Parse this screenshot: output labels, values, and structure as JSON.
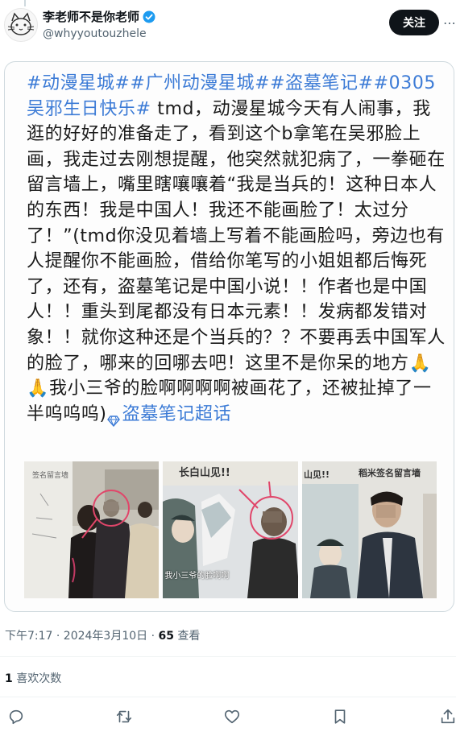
{
  "header": {
    "display_name": "李老师不是你老师",
    "handle": "@whyyoutouzhele",
    "follow_label": "关注",
    "more_label": "⋯"
  },
  "quote": {
    "hashtags": "#动漫星城##广州动漫星城##盗墓笔记##0305吴邪生日快乐#",
    "body": " tmd，动漫星城今天有人闹事，我逛的好好的准备走了，看到这个b拿笔在吴邪脸上画，我走过去刚想提醒，他突然就犯病了，一拳砸在留言墙上，嘴里瞎嚷嚷着“我是当兵的！这种日本人的东西！我是中国人！我还不能画脸了！太过分了！”(tmd你没见着墙上写着不能画脸吗，旁边也有人提醒你不能画脸，借给你笔写的小姐姐都后悔死了，还有，盗墓笔记是中国小说！！作者也是中国人！！重头到尾都没有日本元素！！发病都发错对象！！就你这种还是个当兵的？？不要再丢中国军人的脸了，哪来的回哪去吧！这里不是你呆的地方",
    "emoji": "🙏🙏",
    "body_end": "我小三爷的脸啊啊啊啊被画花了，还被扯掉了一半呜呜呜)",
    "supertopic": "盗墓笔记超话"
  },
  "photos": {
    "photo2_caption": "我小三爷的脸啊啊",
    "photo1_sign": "签名留言墙",
    "photo2_banner": "长白山见!!",
    "photo3_banner": "稻米签名留言墙",
    "photo3_banner2": "山见!!"
  },
  "meta": {
    "time": "下午7:17 · 2024年3月10日 · ",
    "views": "65",
    "views_label": " 查看",
    "likes": "1",
    "likes_label": " 喜欢次数"
  },
  "colors": {
    "accent": "#1d9bf0",
    "hashtag": "#3c7bd6",
    "secondary_text": "#536471"
  },
  "icons": [
    "reply-icon",
    "retweet-icon",
    "like-icon",
    "bookmark-icon",
    "share-icon",
    "verified-icon",
    "more-icon",
    "diamond-icon"
  ]
}
